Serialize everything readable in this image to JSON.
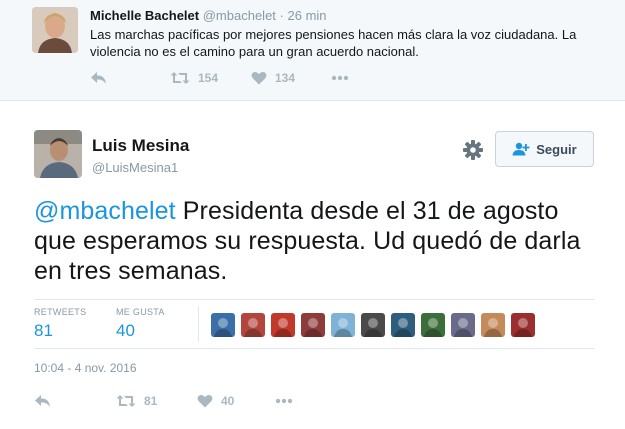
{
  "parent_tweet": {
    "name": "Michelle Bachelet",
    "handle": "@mbachelet",
    "separator": "·",
    "time": "26 min",
    "text": "Las marchas pacíficas por mejores pensiones hacen más clara la voz ciudadana. La violencia no es el camino para un gran acuerdo nacional.",
    "retweets": "154",
    "likes": "134"
  },
  "main_tweet": {
    "name": "Luis Mesina",
    "handle": "@LuisMesina1",
    "follow_label": "Seguir",
    "mention": "@mbachelet",
    "text": " Presidenta desde el 31 de agosto que esperamos su respuesta. Ud quedó de darla en tres semanas.",
    "stats": {
      "retweets_label": "RETWEETS",
      "retweets_value": "81",
      "likes_label": "ME GUSTA",
      "likes_value": "40"
    },
    "timestamp": "10:04 - 4 nov. 2016",
    "action_retweets": "81",
    "action_likes": "40"
  },
  "likers": [
    {
      "icon": "liker-avatar-1",
      "color": "#3a6fa8"
    },
    {
      "icon": "liker-avatar-2",
      "color": "#b2463e"
    },
    {
      "icon": "liker-avatar-3",
      "color": "#c0392b"
    },
    {
      "icon": "liker-avatar-4",
      "color": "#8e3b3b"
    },
    {
      "icon": "liker-avatar-5",
      "color": "#7fb3d5"
    },
    {
      "icon": "liker-avatar-6",
      "color": "#4a4a4a"
    },
    {
      "icon": "liker-avatar-7",
      "color": "#2e5e7e"
    },
    {
      "icon": "liker-avatar-8",
      "color": "#3c6e3c"
    },
    {
      "icon": "liker-avatar-9",
      "color": "#6a6a8a"
    },
    {
      "icon": "liker-avatar-10",
      "color": "#c48a5a"
    },
    {
      "icon": "liker-avatar-11",
      "color": "#9b2f2f"
    }
  ],
  "colors": {
    "link": "#1b95e0",
    "muted": "#8899a6",
    "icon": "#aab8c2",
    "background_parent": "#f5f8fa"
  }
}
